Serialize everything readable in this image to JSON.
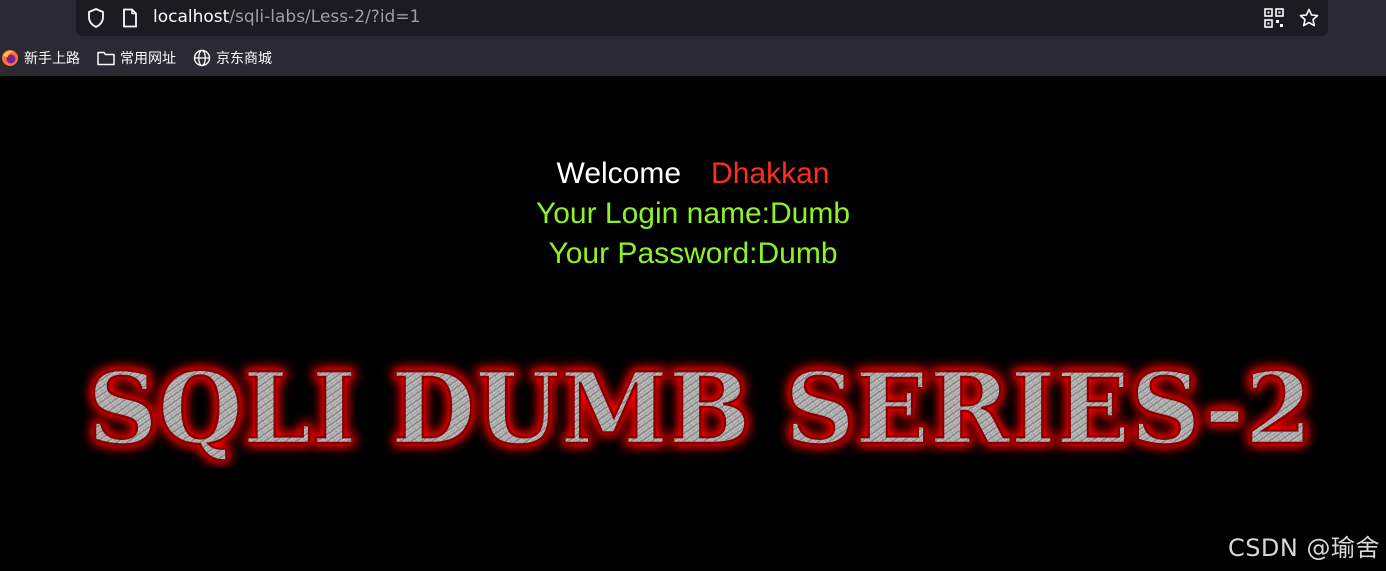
{
  "browser": {
    "url_host": "localhost",
    "url_path": "/sqli-labs/Less-2/?id=1"
  },
  "bookmarks": [
    {
      "label": "新手上路",
      "icon": "firefox-icon"
    },
    {
      "label": "常用网址",
      "icon": "folder-icon"
    },
    {
      "label": "京东商城",
      "icon": "globe-icon"
    }
  ],
  "page": {
    "welcome": "Welcome",
    "username": "Dhakkan",
    "login_line": "Your Login name:Dumb",
    "password_line": "Your Password:Dumb",
    "banner_text": "SQLI DUMB SERIES-2"
  },
  "watermark": "CSDN @瑜舍",
  "colors": {
    "background": "#000000",
    "welcome": "#ffffff",
    "username": "#ff2d1f",
    "info_green": "#8ff227",
    "banner_glow": "#ff0000"
  }
}
